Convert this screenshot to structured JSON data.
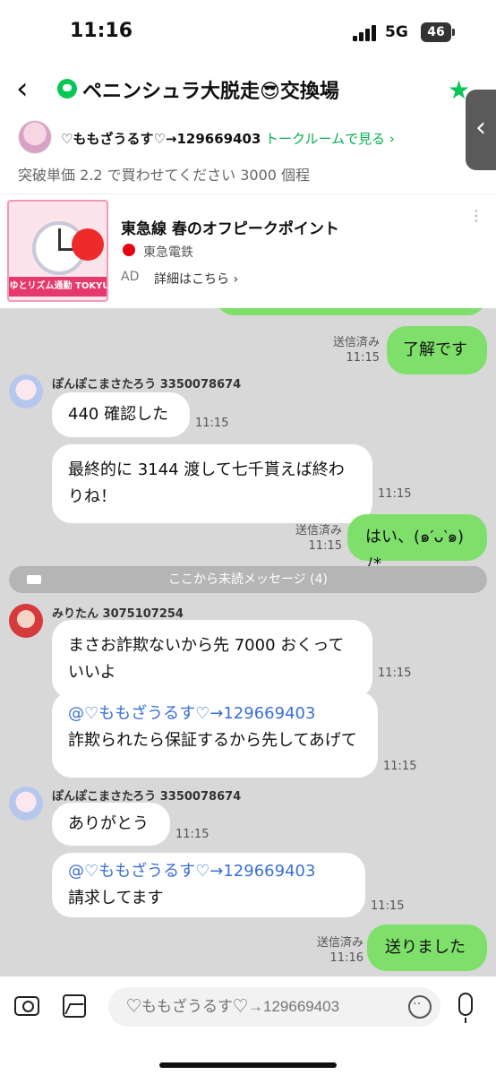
{
  "status": {
    "time": "11:16",
    "network": "5G",
    "battery": "46"
  },
  "header": {
    "title": "ペニンシュラ大脱走😎交換場",
    "host_name": "♡ももざうるす♡→129669403",
    "talk_link": "トークルームで見る ›",
    "notice": "突破単価 2.2 で買わせてください 3000 個程",
    "side_tab": "‹"
  },
  "ad": {
    "title": "東急線 春のオフピークポイント",
    "company": "東急電鉄",
    "label": "AD",
    "link": "詳細はこちら ›",
    "banner": "ゆとリズム通勤 TOKYU POINT",
    "more": "⋮"
  },
  "messages": {
    "m0": {
      "text": "了解です",
      "status": "送信済み",
      "time": "11:15"
    },
    "m1": {
      "sender": "ぽんぽこまさたろう 3350078674",
      "text": "440 確認した",
      "time": "11:15"
    },
    "m2": {
      "text": "最終的に 3144 渡して七千貰えば終わりね！",
      "time": "11:15"
    },
    "m3": {
      "text": "はい、(๑′ᴗ‵๑)ﾉ*",
      "status": "送信済み",
      "time": "11:15"
    },
    "unread": "ここから未読メッセージ (4)",
    "m4": {
      "sender": "みりたん 3075107254",
      "text": "まさお詐欺ないから先 7000 おくっていいよ",
      "time": "11:15"
    },
    "m5": {
      "mention": "@♡ももざうるす♡→129669403",
      "text": "詐欺られたら保証するから先してあげて",
      "time": "11:15"
    },
    "m6": {
      "sender": "ぽんぽこまさたろう 3350078674",
      "text": "ありがとう",
      "time": "11:15"
    },
    "m7": {
      "mention": "@♡ももざうるす♡→129669403",
      "text": "請求してます",
      "time": "11:15"
    },
    "m8": {
      "text": "送りました",
      "status": "送信済み",
      "time": "11:16"
    }
  },
  "composer": {
    "placeholder": "♡ももざうるす♡→129669403"
  },
  "colors": {
    "accent": "#06c755",
    "out_bubble": "#7ee06a",
    "mention": "#3a6fd8"
  }
}
